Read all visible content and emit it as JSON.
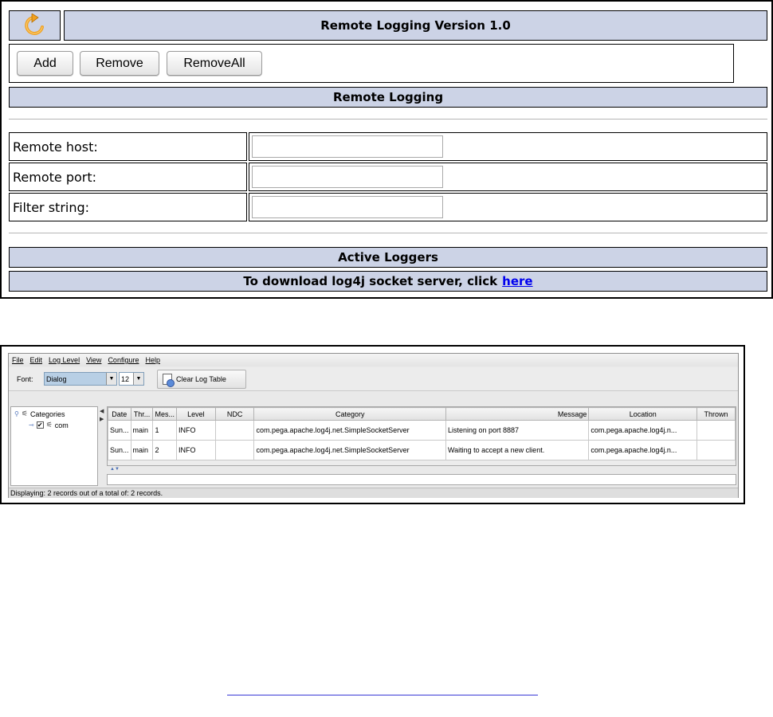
{
  "remote_logging": {
    "logo_icon": "refresh-arrow-icon",
    "title": "Remote Logging Version 1.0",
    "buttons": {
      "add": "Add",
      "remove": "Remove",
      "remove_all": "RemoveAll"
    },
    "section_title": "Remote Logging",
    "fields": [
      {
        "label": "Remote host:",
        "value": ""
      },
      {
        "label": "Remote port:",
        "value": ""
      },
      {
        "label": "Filter string:",
        "value": ""
      }
    ],
    "active_loggers": "Active Loggers",
    "download_text": "To download log4j socket server, click",
    "download_link": "here",
    "colors": {
      "header_bg": "#ccd3e6",
      "link": "#0000ee"
    }
  },
  "log_viewer": {
    "menu": [
      "File",
      "Edit",
      "Log Level",
      "View",
      "Configure",
      "Help"
    ],
    "font_label": "Font:",
    "font_value": "Dialog",
    "size_value": "12",
    "clear_button": "Clear Log Table",
    "tree": {
      "root": "Categories",
      "child": "com",
      "child_checked": true
    },
    "columns": [
      "Date",
      "Thr...",
      "Mes...",
      "Level",
      "NDC",
      "Category",
      "Message",
      "Location",
      "Thrown"
    ],
    "rows": [
      [
        "Sun...",
        "main",
        "1",
        "INFO",
        "",
        "com.pega.apache.log4j.net.SimpleSocketServer",
        "Listening on port 8887",
        "com.pega.apache.log4j.n...",
        ""
      ],
      [
        "Sun...",
        "main",
        "2",
        "INFO",
        "",
        "com.pega.apache.log4j.net.SimpleSocketServer",
        "Waiting to accept a new client.",
        "com.pega.apache.log4j.n...",
        ""
      ]
    ],
    "status": "Displaying: 2 records out of a total of: 2 records."
  }
}
